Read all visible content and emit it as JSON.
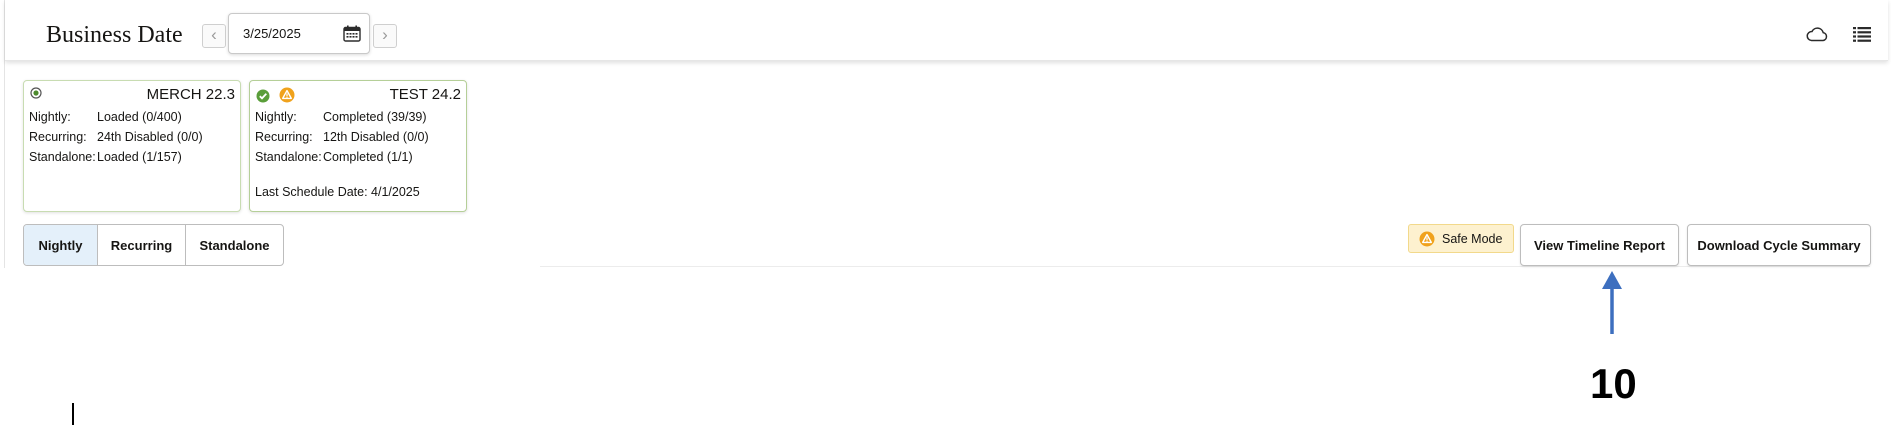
{
  "header": {
    "title": "Business Date",
    "date_value": "3/25/2025",
    "prev_label": "‹",
    "next_label": "›"
  },
  "cards": [
    {
      "name": "MERCH 22.3",
      "status_icons": [
        "radio-dot-icon"
      ],
      "rows": [
        {
          "label": "Nightly:",
          "value": "Loaded (0/400)"
        },
        {
          "label": "Recurring:",
          "value": "24th Disabled (0/0)"
        },
        {
          "label": "Standalone:",
          "value": "Loaded (1/157)"
        }
      ],
      "footer": ""
    },
    {
      "name": "TEST 24.2",
      "status_icons": [
        "check-circle-icon",
        "warning-icon"
      ],
      "rows": [
        {
          "label": "Nightly:",
          "value": "Completed (39/39)"
        },
        {
          "label": "Recurring:",
          "value": "12th Disabled (0/0)"
        },
        {
          "label": "Standalone:",
          "value": "Completed (1/1)"
        }
      ],
      "footer": "Last Schedule Date: 4/1/2025"
    }
  ],
  "tabs": {
    "nightly": "Nightly",
    "recurring": "Recurring",
    "standalone": "Standalone",
    "selected": "Nightly"
  },
  "actions": {
    "safe_mode": "Safe Mode",
    "timeline_report": "View Timeline Report",
    "download_summary": "Download Cycle Summary"
  },
  "annotation": {
    "number": "10"
  },
  "colors": {
    "selected_tab_bg": "#e4f0fa",
    "safe_mode_bg": "#fdf1cf",
    "success_green": "#5a9e3a",
    "warning_orange": "#f0a21c",
    "arrow_blue": "#3d6fbf"
  }
}
